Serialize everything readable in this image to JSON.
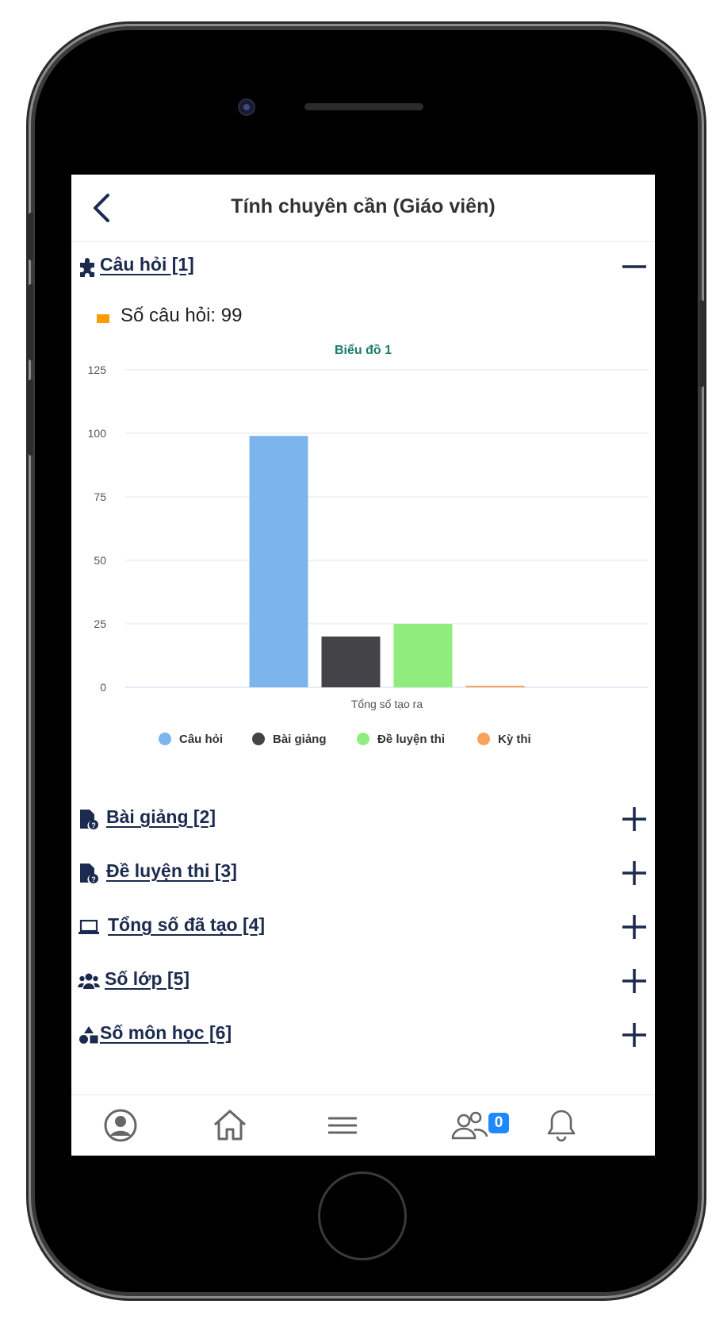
{
  "header": {
    "title": "Tính chuyên cần (Giáo viên)"
  },
  "sections": [
    {
      "label": "Câu hỏi [1]",
      "icon": "puzzle-icon",
      "state": "expanded"
    },
    {
      "label": "Bài giảng [2]",
      "icon": "file-question-icon",
      "state": "collapsed"
    },
    {
      "label": "Đề luyện thi [3]",
      "icon": "file-question-icon",
      "state": "collapsed"
    },
    {
      "label": "Tổng số đã tạo [4]",
      "icon": "laptop-icon",
      "state": "collapsed"
    },
    {
      "label": "Số lớp [5]",
      "icon": "users-icon",
      "state": "collapsed"
    },
    {
      "label": "Số môn học [6]",
      "icon": "shapes-icon",
      "state": "collapsed"
    }
  ],
  "summary": {
    "text": "Số câu hỏi: 99",
    "color": "#ff9b00"
  },
  "chart_data": {
    "type": "bar",
    "title": "Biểu đồ 1",
    "categories": [
      "Tổng số tạo ra"
    ],
    "xlabel": "",
    "ylabel": "",
    "ylim": [
      0,
      125
    ],
    "yticks": [
      "0",
      "25",
      "50",
      "75",
      "100",
      "125"
    ],
    "grid": true,
    "legend_position": "bottom",
    "series": [
      {
        "name": "Câu hỏi",
        "values": [
          99
        ],
        "color": "#7cb5ec"
      },
      {
        "name": "Bài giảng",
        "values": [
          20
        ],
        "color": "#434348"
      },
      {
        "name": "Đề luyện thi",
        "values": [
          25
        ],
        "color": "#90ed7d"
      },
      {
        "name": "Kỳ thi",
        "values": [
          0
        ],
        "color": "#f7a35c"
      }
    ]
  },
  "tabbar": {
    "items": [
      {
        "icon": "profile-icon"
      },
      {
        "icon": "home-icon"
      },
      {
        "icon": "menu-icon"
      },
      {
        "icon": "group-icon",
        "badge": "0"
      },
      {
        "icon": "bell-icon"
      }
    ]
  },
  "colors": {
    "accent": "#1b2a4e",
    "title": "#1a7a6e",
    "badge": "#1e88ff"
  }
}
